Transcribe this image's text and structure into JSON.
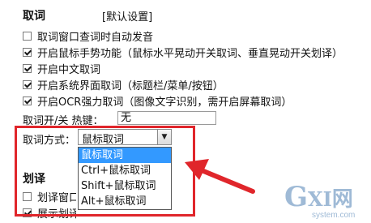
{
  "section_main": {
    "title": "取词",
    "default_settings": "[默认设置]"
  },
  "options": [
    {
      "label": "取词窗口查词时自动发音",
      "checked": false
    },
    {
      "label": "开启鼠标手势功能（鼠标水平晃动开关取词、垂直晃动开关划译）",
      "checked": true
    },
    {
      "label": "开启中文取词",
      "checked": true
    },
    {
      "label": "开启系统界面取词（标题栏/菜单/按钮）",
      "checked": true
    },
    {
      "label": "开启OCR强力取词（图像文字识别，需开启屏幕取词）",
      "checked": true
    }
  ],
  "hotkey": {
    "label": "取词开/关 热键：",
    "value": "无"
  },
  "mode": {
    "label": "取词方式：",
    "selected": "鼠标取词",
    "options": [
      "鼠标取词",
      "Ctrl+鼠标取词",
      "Shift+鼠标取词",
      "Alt+鼠标取词"
    ]
  },
  "section_translate": {
    "title": "划译",
    "options": [
      {
        "label": "划译窗口",
        "checked": false
      },
      {
        "label": "展示划译图标",
        "checked": true
      }
    ]
  },
  "watermark": {
    "brand_g": "G",
    "brand_x": "X",
    "brand_i": "I",
    "brand_wang": "网",
    "domain": "system.com"
  },
  "colors": {
    "highlight": "#e0262b",
    "selection": "#3399ff",
    "watermark": "#9fbad6"
  }
}
